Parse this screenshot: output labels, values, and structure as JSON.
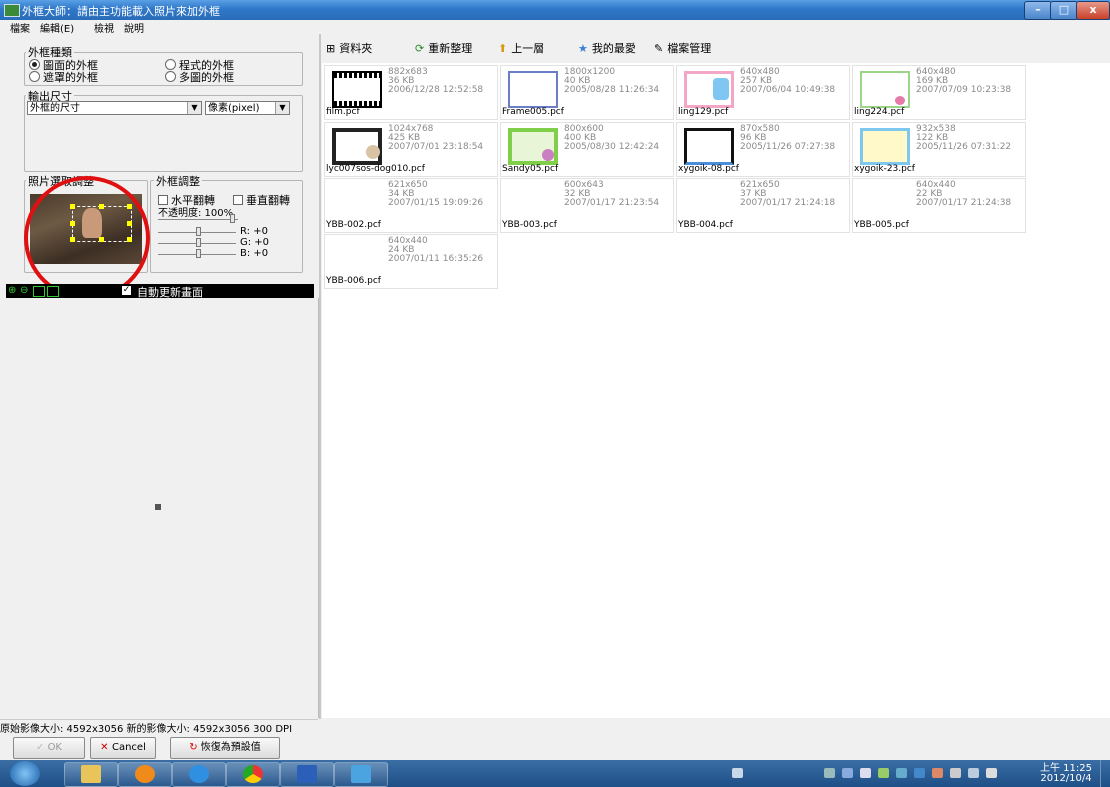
{
  "window": {
    "title": "外框大師：請由主功能載入照片來加外框"
  },
  "menu": [
    "檔案",
    "編輯(E)",
    "檢視",
    "說明"
  ],
  "frame_type": {
    "label": "外框種類",
    "options": [
      "圖面的外框",
      "程式的外框",
      "遮罩的外框",
      "多圖的外框"
    ],
    "selected": "圖面的外框"
  },
  "output_size": {
    "label": "輸出尺寸",
    "size_value": "外框的尺寸",
    "unit_value": "像素(pixel)"
  },
  "photo_crop": {
    "label": "照片選取調整"
  },
  "frame_adjust": {
    "label": "外框調整",
    "flip_h": "水平翻轉",
    "flip_v": "垂直翻轉",
    "opacity": "不透明度: 100%",
    "r": "R: +0",
    "g": "G: +0",
    "b": "B: +0"
  },
  "preview": {
    "auto_update": "自動更新畫面"
  },
  "status": {
    "text": "原始影像大小: 4592x3056   新的影像大小: 4592x3056 300 DPI"
  },
  "buttons": {
    "ok": "OK",
    "cancel": "Cancel",
    "reset": "恢復為預設值"
  },
  "toolbar": {
    "folder": "資料夾",
    "refresh": "重新整理",
    "up": "上一層",
    "favorites": "我的最愛",
    "file_manager": "檔案管理"
  },
  "files": [
    {
      "name": "film.pcf",
      "dims": "882x683",
      "size": "36 KB",
      "date": "2006/12/28 12:52:58"
    },
    {
      "name": "Frame005.pcf",
      "dims": "1800x1200",
      "size": "40 KB",
      "date": "2005/08/28 11:26:34"
    },
    {
      "name": "ling129.pcf",
      "dims": "640x480",
      "size": "257 KB",
      "date": "2007/06/04 10:49:38"
    },
    {
      "name": "ling224.pcf",
      "dims": "640x480",
      "size": "169 KB",
      "date": "2007/07/09 10:23:38"
    },
    {
      "name": "lyc007sos-dog010.pcf",
      "dims": "1024x768",
      "size": "425 KB",
      "date": "2007/07/01 23:18:54"
    },
    {
      "name": "Sandy05.pcf",
      "dims": "800x600",
      "size": "400 KB",
      "date": "2005/08/30 12:42:24"
    },
    {
      "name": "xygoik-08.pcf",
      "dims": "870x580",
      "size": "96 KB",
      "date": "2005/11/26 07:27:38"
    },
    {
      "name": "xygoik-23.pcf",
      "dims": "932x538",
      "size": "122 KB",
      "date": "2005/11/26 07:31:22"
    },
    {
      "name": "YBB-002.pcf",
      "dims": "621x650",
      "size": "34 KB",
      "date": "2007/01/15 19:09:26"
    },
    {
      "name": "YBB-003.pcf",
      "dims": "600x643",
      "size": "32 KB",
      "date": "2007/01/17 21:23:54"
    },
    {
      "name": "YBB-004.pcf",
      "dims": "621x650",
      "size": "37 KB",
      "date": "2007/01/17 21:24:18"
    },
    {
      "name": "YBB-005.pcf",
      "dims": "640x440",
      "size": "22 KB",
      "date": "2007/01/17 21:24:38"
    },
    {
      "name": "YBB-006.pcf",
      "dims": "640x440",
      "size": "24 KB",
      "date": "2007/01/11 16:35:26"
    }
  ],
  "clock": {
    "time": "上午 11:25",
    "date": "2012/10/4"
  }
}
